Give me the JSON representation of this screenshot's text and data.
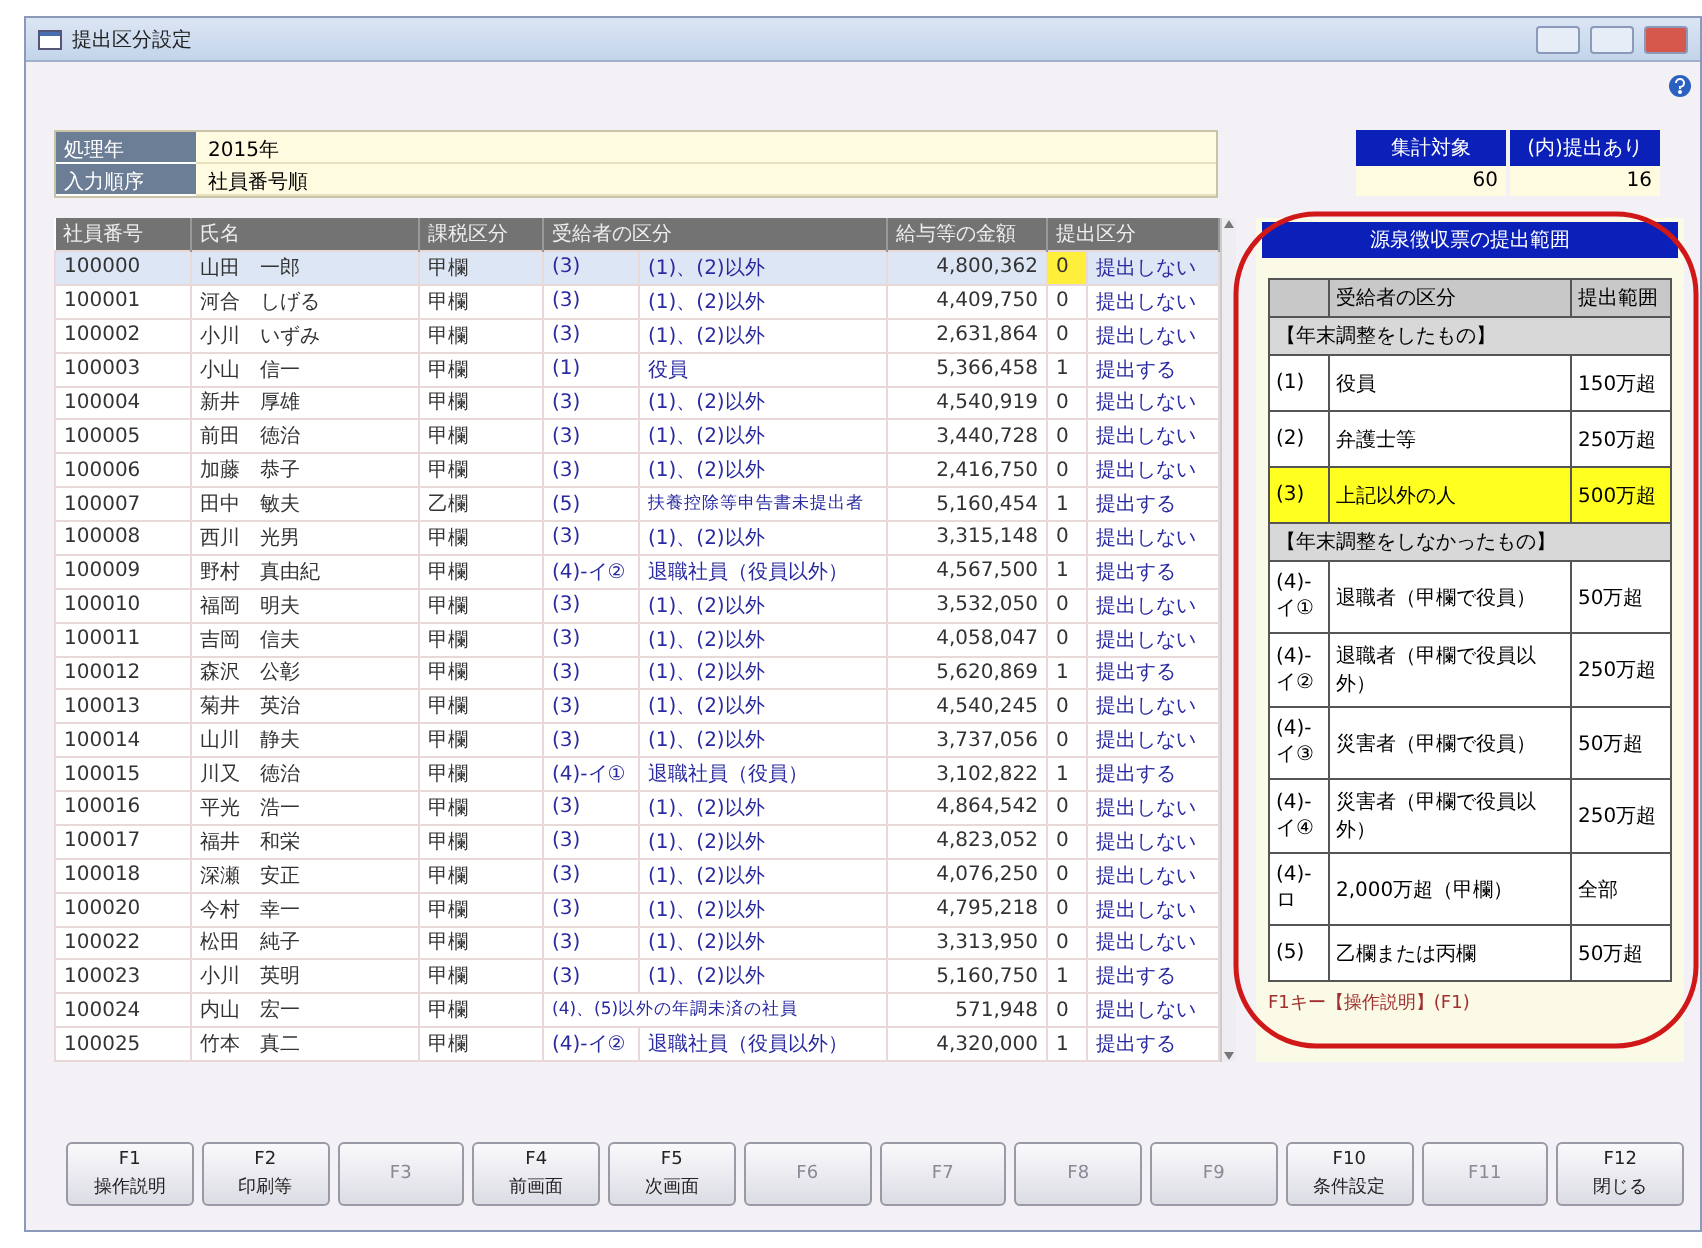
{
  "window": {
    "title": "提出区分設定"
  },
  "info": [
    {
      "label": "処理年",
      "value": "2015年"
    },
    {
      "label": "入力順序",
      "value": "社員番号順"
    }
  ],
  "summary": {
    "columns": [
      "集計対象",
      "(内)提出あり"
    ],
    "values": [
      "60",
      "16"
    ]
  },
  "table": {
    "columns": [
      "社員番号",
      "氏名",
      "課税区分",
      "受給者の区分",
      "給与等の金額",
      "提出区分"
    ],
    "rows": [
      {
        "id": "100000",
        "name": "山田　一郎",
        "tax": "甲欄",
        "code": "(3)",
        "desc": "(1)、(2)以外",
        "amount": "4,800,362",
        "flag": "0",
        "submit": "提出しない",
        "selected": true
      },
      {
        "id": "100001",
        "name": "河合　しげる",
        "tax": "甲欄",
        "code": "(3)",
        "desc": "(1)、(2)以外",
        "amount": "4,409,750",
        "flag": "0",
        "submit": "提出しない",
        "selected": false
      },
      {
        "id": "100002",
        "name": "小川　いずみ",
        "tax": "甲欄",
        "code": "(3)",
        "desc": "(1)、(2)以外",
        "amount": "2,631,864",
        "flag": "0",
        "submit": "提出しない",
        "selected": false
      },
      {
        "id": "100003",
        "name": "小山　信一",
        "tax": "甲欄",
        "code": "(1)",
        "desc": "役員",
        "amount": "5,366,458",
        "flag": "1",
        "submit": "提出する",
        "selected": false
      },
      {
        "id": "100004",
        "name": "新井　厚雄",
        "tax": "甲欄",
        "code": "(3)",
        "desc": "(1)、(2)以外",
        "amount": "4,540,919",
        "flag": "0",
        "submit": "提出しない",
        "selected": false
      },
      {
        "id": "100005",
        "name": "前田　徳治",
        "tax": "甲欄",
        "code": "(3)",
        "desc": "(1)、(2)以外",
        "amount": "3,440,728",
        "flag": "0",
        "submit": "提出しない",
        "selected": false
      },
      {
        "id": "100006",
        "name": "加藤　恭子",
        "tax": "甲欄",
        "code": "(3)",
        "desc": "(1)、(2)以外",
        "amount": "2,416,750",
        "flag": "0",
        "submit": "提出しない",
        "selected": false
      },
      {
        "id": "100007",
        "name": "田中　敏夫",
        "tax": "乙欄",
        "code": "(5)",
        "desc": "扶養控除等申告書未提出者",
        "amount": "5,160,454",
        "flag": "1",
        "submit": "提出する",
        "selected": false
      },
      {
        "id": "100008",
        "name": "西川　光男",
        "tax": "甲欄",
        "code": "(3)",
        "desc": "(1)、(2)以外",
        "amount": "3,315,148",
        "flag": "0",
        "submit": "提出しない",
        "selected": false
      },
      {
        "id": "100009",
        "name": "野村　真由紀",
        "tax": "甲欄",
        "code": "(4)-イ②",
        "desc": "退職社員（役員以外）",
        "amount": "4,567,500",
        "flag": "1",
        "submit": "提出する",
        "selected": false
      },
      {
        "id": "100010",
        "name": "福岡　明夫",
        "tax": "甲欄",
        "code": "(3)",
        "desc": "(1)、(2)以外",
        "amount": "3,532,050",
        "flag": "0",
        "submit": "提出しない",
        "selected": false
      },
      {
        "id": "100011",
        "name": "吉岡　信夫",
        "tax": "甲欄",
        "code": "(3)",
        "desc": "(1)、(2)以外",
        "amount": "4,058,047",
        "flag": "0",
        "submit": "提出しない",
        "selected": false
      },
      {
        "id": "100012",
        "name": "森沢　公彰",
        "tax": "甲欄",
        "code": "(3)",
        "desc": "(1)、(2)以外",
        "amount": "5,620,869",
        "flag": "1",
        "submit": "提出する",
        "selected": false
      },
      {
        "id": "100013",
        "name": "菊井　英治",
        "tax": "甲欄",
        "code": "(3)",
        "desc": "(1)、(2)以外",
        "amount": "4,540,245",
        "flag": "0",
        "submit": "提出しない",
        "selected": false
      },
      {
        "id": "100014",
        "name": "山川　静夫",
        "tax": "甲欄",
        "code": "(3)",
        "desc": "(1)、(2)以外",
        "amount": "3,737,056",
        "flag": "0",
        "submit": "提出しない",
        "selected": false
      },
      {
        "id": "100015",
        "name": "川又　徳治",
        "tax": "甲欄",
        "code": "(4)-イ①",
        "desc": "退職社員（役員）",
        "amount": "3,102,822",
        "flag": "1",
        "submit": "提出する",
        "selected": false
      },
      {
        "id": "100016",
        "name": "平光　浩一",
        "tax": "甲欄",
        "code": "(3)",
        "desc": "(1)、(2)以外",
        "amount": "4,864,542",
        "flag": "0",
        "submit": "提出しない",
        "selected": false
      },
      {
        "id": "100017",
        "name": "福井　和栄",
        "tax": "甲欄",
        "code": "(3)",
        "desc": "(1)、(2)以外",
        "amount": "4,823,052",
        "flag": "0",
        "submit": "提出しない",
        "selected": false
      },
      {
        "id": "100018",
        "name": "深瀬　安正",
        "tax": "甲欄",
        "code": "(3)",
        "desc": "(1)、(2)以外",
        "amount": "4,076,250",
        "flag": "0",
        "submit": "提出しない",
        "selected": false
      },
      {
        "id": "100020",
        "name": "今村　幸一",
        "tax": "甲欄",
        "code": "(3)",
        "desc": "(1)、(2)以外",
        "amount": "4,795,218",
        "flag": "0",
        "submit": "提出しない",
        "selected": false
      },
      {
        "id": "100022",
        "name": "松田　純子",
        "tax": "甲欄",
        "code": "(3)",
        "desc": "(1)、(2)以外",
        "amount": "3,313,950",
        "flag": "0",
        "submit": "提出しない",
        "selected": false
      },
      {
        "id": "100023",
        "name": "小川　英明",
        "tax": "甲欄",
        "code": "(3)",
        "desc": "(1)、(2)以外",
        "amount": "5,160,750",
        "flag": "1",
        "submit": "提出する",
        "selected": false
      },
      {
        "id": "100024",
        "name": "内山　宏一",
        "tax": "甲欄",
        "desc": "(4)、(5)以外の年調未済の社員",
        "amount": "571,948",
        "flag": "0",
        "submit": "提出しない",
        "selected": false
      },
      {
        "id": "100025",
        "name": "竹本　真二",
        "tax": "甲欄",
        "code": "(4)-イ②",
        "desc": "退職社員（役員以外）",
        "amount": "4,320,000",
        "flag": "1",
        "submit": "提出する",
        "selected": false
      }
    ]
  },
  "range_panel": {
    "title": "源泉徴収票の提出範囲",
    "columns": [
      "受給者の区分",
      "提出範囲"
    ],
    "rows": [
      {
        "kind": "section",
        "text": "【年末調整をしたもの】"
      },
      {
        "kind": "row",
        "code": "(1)",
        "label": "役員",
        "range": "150万超",
        "highlighted": false
      },
      {
        "kind": "row",
        "code": "(2)",
        "label": "弁護士等",
        "range": "250万超",
        "highlighted": false
      },
      {
        "kind": "row",
        "code": "(3)",
        "label": "上記以外の人",
        "range": "500万超",
        "highlighted": true
      },
      {
        "kind": "section",
        "text": "【年末調整をしなかったもの】"
      },
      {
        "kind": "row",
        "code": "(4)-イ①",
        "label": "退職者（甲欄で役員）",
        "range": "50万超",
        "highlighted": false
      },
      {
        "kind": "row",
        "code": "(4)-イ②",
        "label": "退職者（甲欄で役員以外）",
        "range": "250万超",
        "highlighted": false
      },
      {
        "kind": "row",
        "code": "(4)-イ③",
        "label": "災害者（甲欄で役員）",
        "range": "50万超",
        "highlighted": false
      },
      {
        "kind": "row",
        "code": "(4)-イ④",
        "label": "災害者（甲欄で役員以外）",
        "range": "250万超",
        "highlighted": false
      },
      {
        "kind": "row",
        "code": "(4)-ロ",
        "label": "2,000万超（甲欄）",
        "range": "全部",
        "highlighted": false
      },
      {
        "kind": "row",
        "code": "(5)",
        "label": "乙欄または丙欄",
        "range": "50万超",
        "highlighted": false
      }
    ],
    "note": "F1キー【操作説明】(F1)"
  },
  "function_keys": [
    {
      "key": "F1",
      "label": "操作説明",
      "disabled": false
    },
    {
      "key": "F2",
      "label": "印刷等",
      "disabled": false
    },
    {
      "key": "F3",
      "disabled": true
    },
    {
      "key": "F4",
      "label": "前画面",
      "disabled": false
    },
    {
      "key": "F5",
      "label": "次画面",
      "disabled": false
    },
    {
      "key": "F6",
      "disabled": true
    },
    {
      "key": "F7",
      "disabled": true
    },
    {
      "key": "F8",
      "disabled": true
    },
    {
      "key": "F9",
      "disabled": true
    },
    {
      "key": "F10",
      "label": "条件設定",
      "disabled": false
    },
    {
      "key": "F11",
      "disabled": true
    },
    {
      "key": "F12",
      "label": "閉じる",
      "disabled": false
    }
  ]
}
